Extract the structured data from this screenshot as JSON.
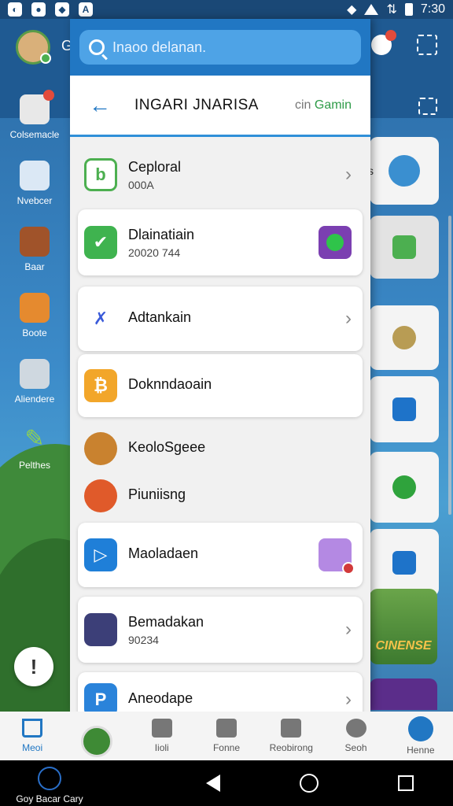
{
  "status_bar": {
    "time": "7:30"
  },
  "header": {
    "letter": "G"
  },
  "rail": [
    {
      "label": "Colsemacle"
    },
    {
      "label": "Nvebcer"
    },
    {
      "label": "Baar"
    },
    {
      "label": "Boote"
    },
    {
      "label": "Aliendere"
    },
    {
      "label": "Pelthes"
    }
  ],
  "help_label": "!",
  "search": {
    "placeholder": "Inaoo delanan."
  },
  "drawer_header": {
    "back": "←",
    "title": "INGARI JNARISA",
    "right_prefix": "cin",
    "right_accent": "Gamin"
  },
  "list": [
    {
      "title": "Ceploral",
      "sub": "000A",
      "trail": "›"
    },
    {
      "title": "Dlainatiain",
      "sub": "20020 744",
      "trail": ""
    },
    {
      "title": "Adtankain",
      "sub": "",
      "trail": "›"
    },
    {
      "title": "Doknndaoain",
      "sub": "",
      "trail": ""
    },
    {
      "title": "KeoloSgeee",
      "sub": "",
      "trail": ""
    },
    {
      "title": "Piuniisng",
      "sub": "",
      "trail": ""
    },
    {
      "title": "Maoladaen",
      "sub": "",
      "trail": ""
    },
    {
      "title": "Bemadakan",
      "sub": "90234",
      "trail": "›"
    },
    {
      "title": "Aneodape",
      "sub": "",
      "trail": "›"
    }
  ],
  "right_col_letter": "s",
  "game_card": {
    "text": "CINENSE"
  },
  "bottom_nav": [
    {
      "label": "Meoi"
    },
    {
      "label": ""
    },
    {
      "label": "Iioli"
    },
    {
      "label": "Fonne"
    },
    {
      "label": "Reobirong"
    },
    {
      "label": "Seoh"
    },
    {
      "label": "Henne"
    }
  ],
  "sys_brand": "Goy Bacar Cary"
}
